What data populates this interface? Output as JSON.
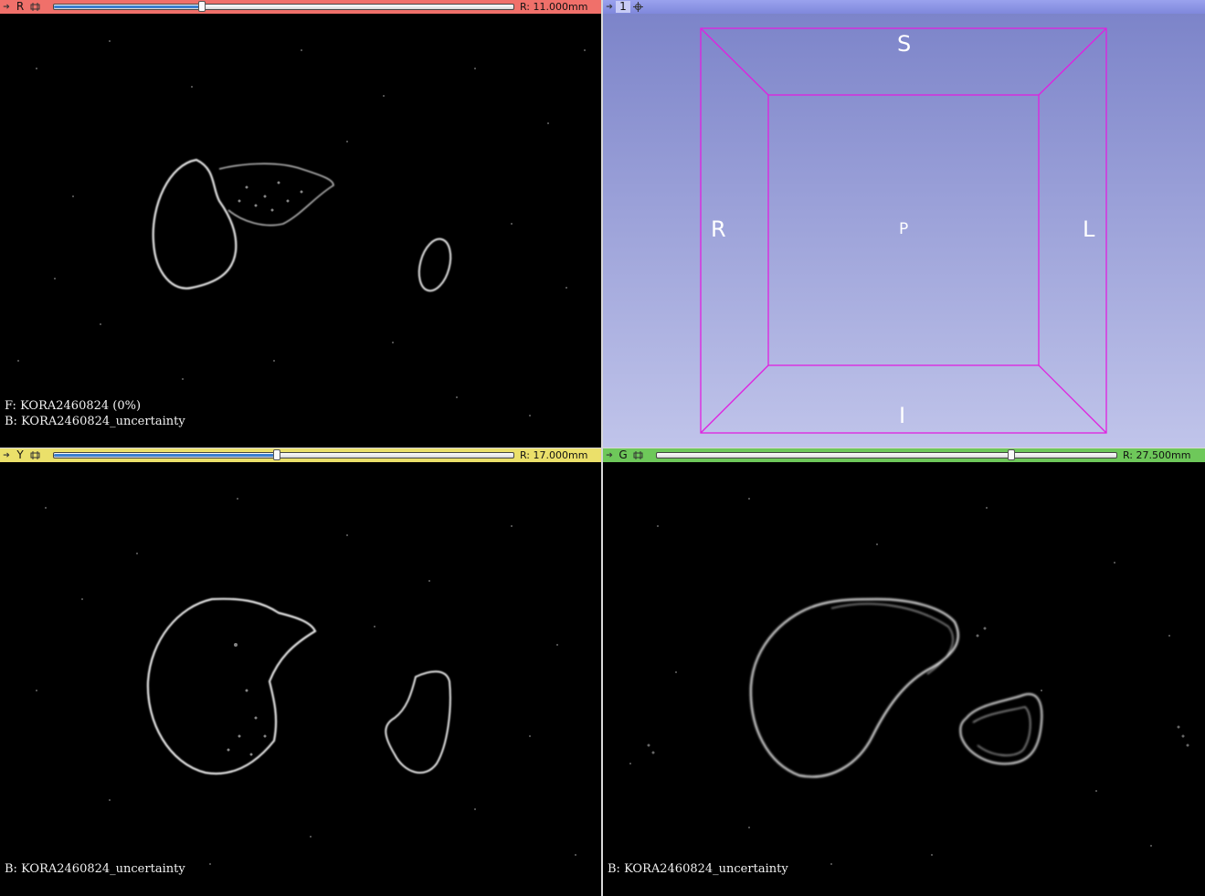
{
  "views": {
    "red": {
      "letter": "R",
      "offset": "R: 11.000mm",
      "slider_fraction": 0.326,
      "color": "#f0706a",
      "annotations": [
        "F: KORA2460824 (0%)",
        "B: KORA2460824_uncertainty"
      ]
    },
    "threed": {
      "letter": "1",
      "color": "#8f98e0",
      "labels": {
        "superior": "S",
        "inferior": "I",
        "right": "R",
        "left": "L",
        "posterior": "P"
      },
      "box_color": "#e020e0"
    },
    "yellow": {
      "letter": "Y",
      "offset": "R: 17.000mm",
      "slider_fraction": 0.488,
      "color": "#ebe06a",
      "annotations": [
        "B: KORA2460824_uncertainty"
      ]
    },
    "green": {
      "letter": "G",
      "offset": "R: 27.500mm",
      "slider_fraction": 0.769,
      "color": "#6ec85a",
      "annotations": [
        "B: KORA2460824_uncertainty"
      ]
    }
  },
  "icons": {
    "pin": "pin-icon",
    "link": "link-icon",
    "view-menu": "view-settings-icon"
  }
}
